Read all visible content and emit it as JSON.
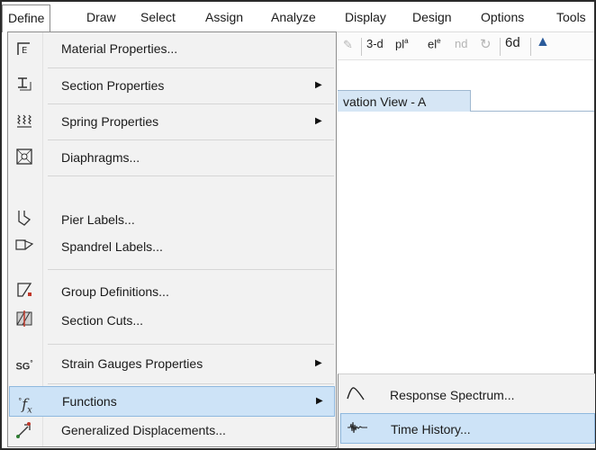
{
  "menubar": {
    "items": [
      "Define",
      "Draw",
      "Select",
      "Assign",
      "Analyze",
      "Display",
      "Design",
      "Options",
      "Tools"
    ]
  },
  "toolbar": {
    "btn_3d": "3-d",
    "btn_plan": "pl",
    "btn_elev": "el",
    "btn_nd": "nd"
  },
  "view_tab": {
    "label": "vation View - A"
  },
  "define_menu": {
    "items": [
      {
        "label": "Material Properties...",
        "icon": "material-icon"
      },
      {
        "label": "Section Properties",
        "icon": "section-icon",
        "submenu": true
      },
      {
        "label": "Spring Properties",
        "icon": "spring-icon",
        "submenu": true
      },
      {
        "label": "Diaphragms...",
        "icon": "diaphragm-icon"
      },
      {
        "label": "Pier Labels...",
        "icon": "pier-icon"
      },
      {
        "label": "Spandrel Labels...",
        "icon": "spandrel-icon"
      },
      {
        "label": "Group Definitions...",
        "icon": "group-icon"
      },
      {
        "label": "Section Cuts...",
        "icon": "section-cut-icon"
      },
      {
        "label": "Strain Gauges Properties",
        "icon": "strain-gauge-icon",
        "submenu": true
      },
      {
        "label": "Functions",
        "icon": "functions-icon",
        "submenu": true
      },
      {
        "label": "Generalized Displacements...",
        "icon": "displacement-icon"
      }
    ]
  },
  "functions_submenu": {
    "items": [
      {
        "label": "Response Spectrum...",
        "icon": "response-spectrum-icon"
      },
      {
        "label": "Time History...",
        "icon": "time-history-icon"
      }
    ]
  }
}
